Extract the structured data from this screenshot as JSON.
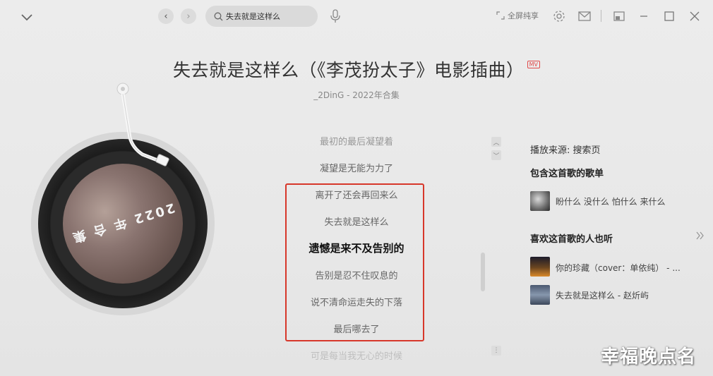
{
  "topbar": {
    "search_value": "失去就是这样么",
    "fullscreen_label": "全屏纯享"
  },
  "song": {
    "title": "失去就是这样么（《李茂扮太子》电影插曲）",
    "mv_badge": "MV",
    "artist_album": "_2DinG - 2022年合集"
  },
  "record": {
    "label_text": "2022 年 合 集"
  },
  "lyrics": [
    {
      "text": "最初的最后凝望着",
      "state": "faded"
    },
    {
      "text": "凝望是无能为力了",
      "state": "normal"
    },
    {
      "text": "离开了还会再回来么",
      "state": "normal"
    },
    {
      "text": "失去就是这样么",
      "state": "normal"
    },
    {
      "text": "遗憾是来不及告别的",
      "state": "current"
    },
    {
      "text": "告别是忍不住叹息的",
      "state": "normal"
    },
    {
      "text": "说不清命运走失的下落",
      "state": "normal"
    },
    {
      "text": "最后哪去了",
      "state": "normal"
    },
    {
      "text": "可是每当我无心的时候",
      "state": "faded"
    }
  ],
  "panel": {
    "source": "播放来源: 搜索页",
    "playlists_heading": "包含这首歌的歌单",
    "playlists": [
      {
        "title": "盼什么 没什么 怕什么 来什么"
      }
    ],
    "also_listen_heading": "喜欢这首歌的人也听",
    "also_listen": [
      {
        "title": "你的珍藏（cover：单依纯） - ..."
      },
      {
        "title": "失去就是这样么 - 赵炘屿"
      }
    ]
  },
  "watermark": "幸福晚点名"
}
